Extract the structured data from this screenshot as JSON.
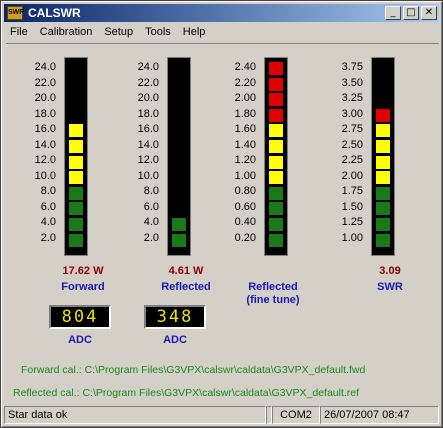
{
  "window": {
    "title": "CALSWR",
    "icon_label": "SWR",
    "min": "_",
    "max": "□",
    "close": "✕"
  },
  "menu": [
    "File",
    "Calibration",
    "Setup",
    "Tools",
    "Help"
  ],
  "meters": [
    {
      "scale": [
        "24.0",
        "22.0",
        "20.0",
        "18.0",
        "16.0",
        "14.0",
        "12.0",
        "10.0",
        "8.0",
        "6.0",
        "4.0",
        "2.0"
      ],
      "segments": [
        "off",
        "off",
        "off",
        "off",
        "yellow",
        "yellow",
        "yellow",
        "yellow",
        "green",
        "green",
        "green",
        "green"
      ],
      "value": "17.62 W",
      "label": "Forward"
    },
    {
      "scale": [
        "24.0",
        "22.0",
        "20.0",
        "18.0",
        "16.0",
        "14.0",
        "12.0",
        "10.0",
        "8.0",
        "6.0",
        "4.0",
        "2.0"
      ],
      "segments": [
        "off",
        "off",
        "off",
        "off",
        "off",
        "off",
        "off",
        "off",
        "off",
        "off",
        "green",
        "green"
      ],
      "value": "4.61 W",
      "label": "Reflected"
    },
    {
      "scale": [
        "2.40",
        "2.20",
        "2.00",
        "1.80",
        "1.60",
        "1.40",
        "1.20",
        "1.00",
        "0.80",
        "0.60",
        "0.40",
        "0.20"
      ],
      "segments": [
        "red",
        "red",
        "red",
        "red",
        "yellow",
        "yellow",
        "yellow",
        "yellow",
        "green",
        "green",
        "green",
        "green"
      ],
      "value": "",
      "label": "Reflected (fine tune)"
    },
    {
      "scale": [
        "3.75",
        "3.50",
        "3.25",
        "3.00",
        "2.75",
        "2.50",
        "2.25",
        "2.00",
        "1.75",
        "1.50",
        "1.25",
        "1.00"
      ],
      "segments": [
        "off",
        "off",
        "off",
        "red",
        "yellow",
        "yellow",
        "yellow",
        "yellow",
        "green",
        "green",
        "green",
        "green"
      ],
      "value": "3.09",
      "label": "SWR"
    }
  ],
  "adc": [
    {
      "reading": "804",
      "label": "ADC"
    },
    {
      "reading": "348",
      "label": "ADC"
    }
  ],
  "cal": {
    "forward": "Forward cal.: C:\\Program Files\\G3VPX\\calswr\\caldata\\G3VPX_default.fwd",
    "reflected": "Reflected cal.: C:\\Program Files\\G3VPX\\calswr\\caldata\\G3VPX_default.ref"
  },
  "status": {
    "message": "Star data ok",
    "empty": "",
    "port": "COM2",
    "datetime": "26/07/2007 08:47"
  },
  "colors": {
    "green": "#1a7a1a",
    "yellow": "#ffff00",
    "red": "#e00000",
    "off": "#000000"
  }
}
